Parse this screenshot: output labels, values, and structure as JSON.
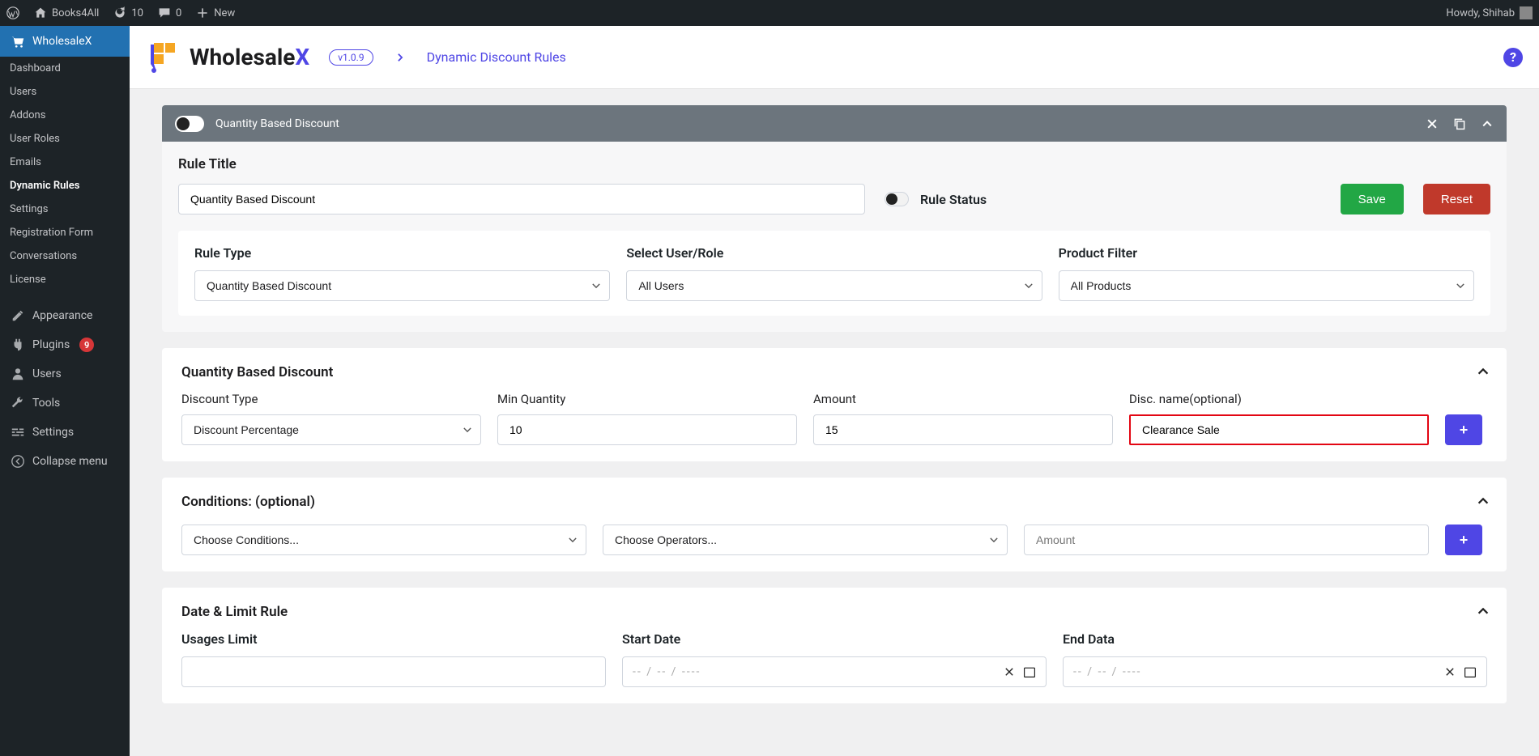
{
  "adminbar": {
    "site_name": "Books4All",
    "updates": "10",
    "comments": "0",
    "new_btn": "New",
    "howdy": "Howdy, Shihab"
  },
  "sidebar": {
    "parent": "WholesaleX",
    "subs": [
      "Dashboard",
      "Users",
      "Addons",
      "User Roles",
      "Emails",
      "Dynamic Rules",
      "Settings",
      "Registration Form",
      "Conversations",
      "License"
    ],
    "active_index": 5,
    "items": {
      "appearance": "Appearance",
      "plugins": "Plugins",
      "plugins_count": "9",
      "users": "Users",
      "tools": "Tools",
      "settings": "Settings",
      "collapse": "Collapse menu"
    }
  },
  "topbar": {
    "brand_prefix": "Wholesale",
    "brand_suffix": "X",
    "version": "v1.0.9",
    "crumb": "Dynamic Discount Rules"
  },
  "rulebar": {
    "title": "Quantity Based Discount"
  },
  "rule_title": {
    "label": "Rule Title",
    "value": "Quantity Based Discount",
    "status_label": "Rule Status",
    "save": "Save",
    "reset": "Reset"
  },
  "type_row": {
    "rule_type_label": "Rule Type",
    "rule_type_value": "Quantity Based Discount",
    "user_label": "Select User/Role",
    "user_value": "All Users",
    "product_label": "Product Filter",
    "product_value": "All Products"
  },
  "qbd": {
    "title": "Quantity Based Discount",
    "c1": "Discount Type",
    "c1_value": "Discount Percentage",
    "c2": "Min Quantity",
    "c2_value": "10",
    "c3": "Amount",
    "c3_value": "15",
    "c4": "Disc. name(optional)",
    "c4_value": "Clearance Sale"
  },
  "cond": {
    "title": "Conditions: (optional)",
    "c1": "Choose Conditions...",
    "c2": "Choose Operators...",
    "c3_placeholder": "Amount"
  },
  "datelimit": {
    "title": "Date & Limit Rule",
    "usage": "Usages Limit",
    "start": "Start Date",
    "end": "End Data",
    "date_ph": "-- / --  / ----"
  }
}
